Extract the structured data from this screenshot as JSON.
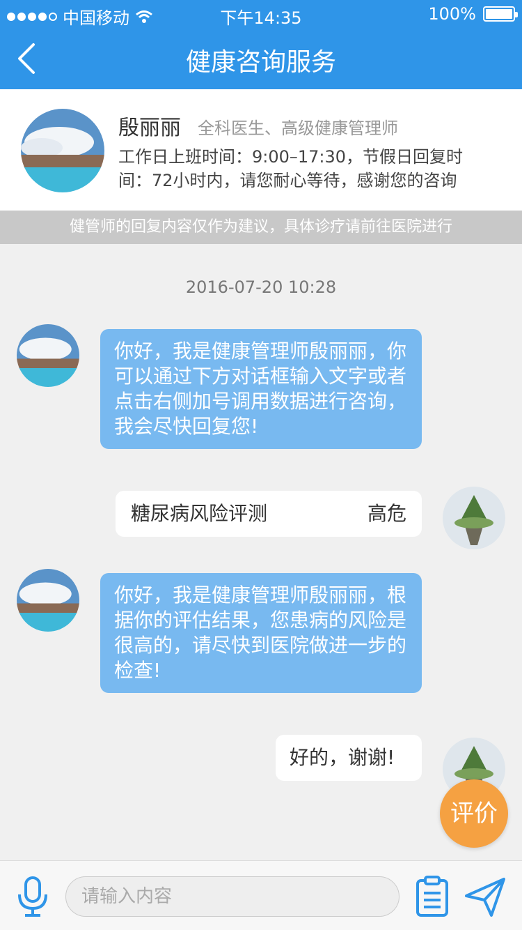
{
  "status_bar": {
    "carrier": "中国移动",
    "time": "下午14:35",
    "battery": "100%"
  },
  "nav": {
    "title": "健康咨询服务"
  },
  "doctor": {
    "name": "殷丽丽",
    "role": "全科医生、高级健康管理师",
    "hours_line1": "工作日上班时间：9:00–17:30，节假日回复时",
    "hours_line2": "间：72小时内，请您耐心等待，感谢您的咨询"
  },
  "notice": "健管师的回复内容仅作为建议，具体诊疗请前往医院进行",
  "chat": {
    "date": "2016-07-20  10:28",
    "msg1": "你好，我是健康管理师殷丽丽，你可以通过下方对话框输入文字或者点击右侧加号调用数据进行咨询，我会尽快回复您!",
    "risk_title": "糖尿病风险评测",
    "risk_level": "高危",
    "msg2": "你好，我是健康管理师殷丽丽，根据你的评估结果，您患病的风险是很高的，请尽快到医院做进一步的检查!",
    "msg3": "好的，谢谢!"
  },
  "rate_button": "评价",
  "input": {
    "placeholder": "请输入内容"
  },
  "colors": {
    "primary": "#2f95e8",
    "bubble": "#78b9f0",
    "rate": "#f5a142"
  }
}
